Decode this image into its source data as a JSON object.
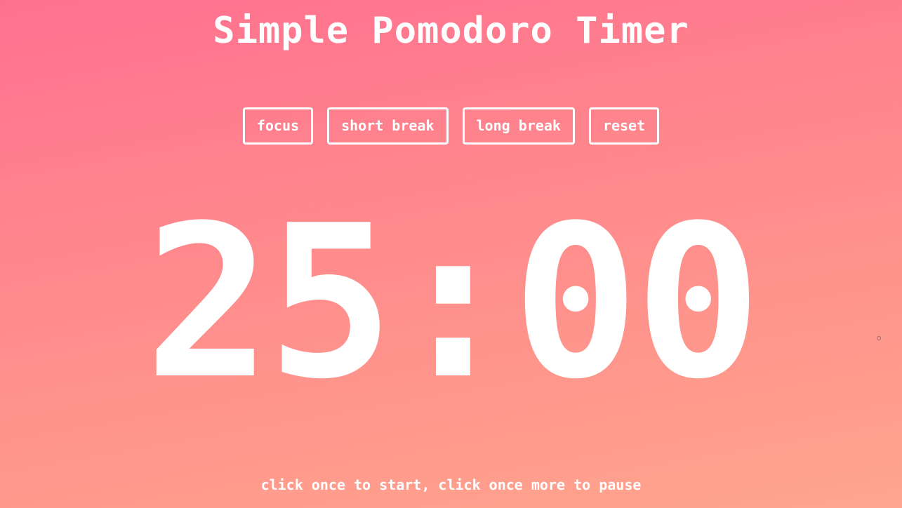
{
  "header": {
    "title": "Simple Pomodoro Timer"
  },
  "modes": [
    {
      "label": "focus"
    },
    {
      "label": "short break"
    },
    {
      "label": "long break"
    },
    {
      "label": "reset"
    }
  ],
  "timer": {
    "display": "25:00"
  },
  "footer": {
    "hint": "click once to start, click once more to pause"
  },
  "colors": {
    "gradient_top": "#ff7090",
    "gradient_bottom": "#ffa58d",
    "text": "#ffffff"
  }
}
